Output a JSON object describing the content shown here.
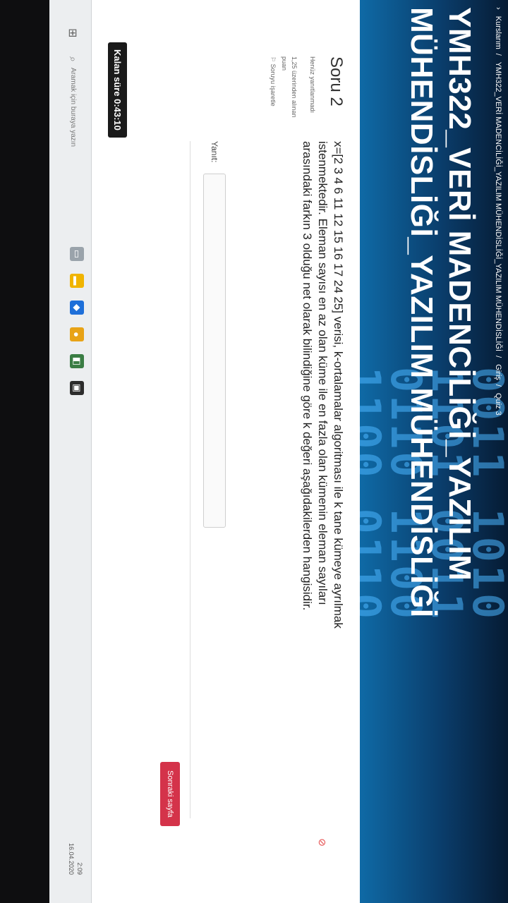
{
  "breadcrumb": [
    "Kurslarım",
    "YMH322_VERİ MADENCİLİĞİ_YAZILIM MÜHENDİSLİĞİ_YAZILIM MÜHENDİSLİĞİ",
    "Giriş",
    "Quiz 3"
  ],
  "course_title": "YMH322_VERİ MADENCİLİĞİ_YAZILIM MÜHENDİSLİĞİ_YAZILIM MÜHENDİSLİĞİ",
  "question": {
    "title": "Soru 2",
    "status": "Henüz yanıtlanmadı",
    "points": "1,25 üzerinden alınan puan",
    "flag_label": "Soruyu işaretle",
    "text_line1": "x=[2 3 4 6 11 12 15 16 17 24 25] verisi, k-ortalamalar algoritması ile k tane kümeye ayrılmak",
    "text_line2": "istenmektedir. Eleman sayısı en az olan küme ile en fazla olan kümenin eleman sayıları",
    "text_line3": "arasındaki farkın 3 olduğu net olarak bilindiğine göre k değeri aşağıdakilerden hangisidir."
  },
  "answer": {
    "label": "Yanıt:"
  },
  "next_button": "Sonraki sayfa",
  "timer": "Kalan süre 0:43:10",
  "taskbar": {
    "search_placeholder": "Aramak için buraya yazın",
    "clock": "2:09",
    "date": "16.04.2020"
  }
}
